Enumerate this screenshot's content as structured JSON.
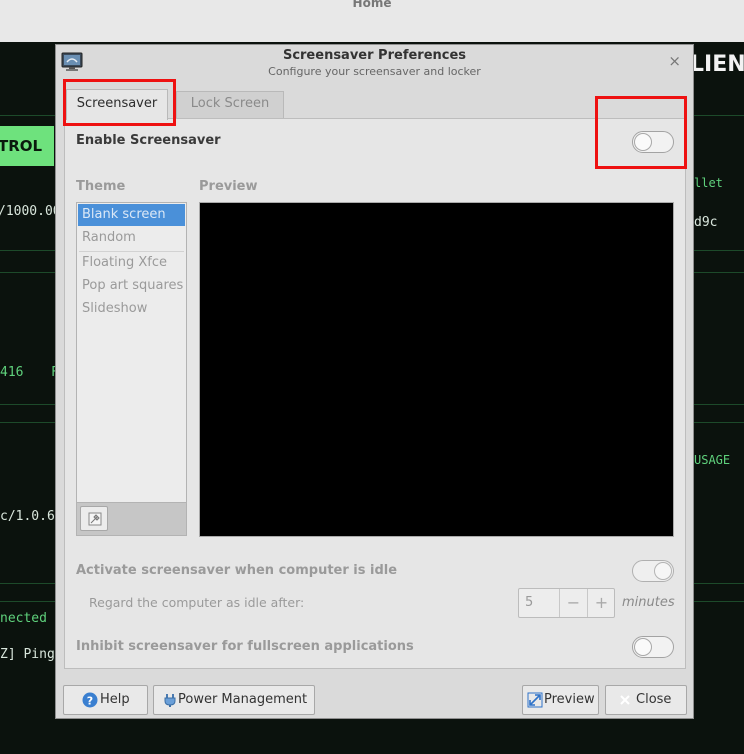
{
  "background_window": {
    "title": "Home",
    "fragments": {
      "client_header": "LIEN",
      "control_badge": "TROL",
      "value_1": "/1000.00",
      "wallet": "llet",
      "hash": "d9c",
      "num": "416",
      "letter_f": "F",
      "usage": "USAGE",
      "version": "c/1.0.6",
      "connected": "nected t",
      "pinging": "Z] Pingin"
    }
  },
  "dialog": {
    "title": "Screensaver Preferences",
    "subtitle": "Configure your screensaver and locker",
    "close_glyph": "×",
    "tabs": [
      {
        "label": "Screensaver",
        "active": true
      },
      {
        "label": "Lock Screen",
        "active": false
      }
    ],
    "enable_label": "Enable Screensaver",
    "enable_on": false,
    "theme_header": "Theme",
    "preview_header": "Preview",
    "themes": [
      "Blank screen",
      "Random",
      "Floating Xfce",
      "Pop art squares",
      "Slideshow"
    ],
    "selected_theme": "Blank screen",
    "activate_label": "Activate screensaver when computer is idle",
    "activate_on": true,
    "idle_label": "Regard the computer as idle after:",
    "idle_value": "5",
    "idle_minus": "−",
    "idle_plus": "+",
    "idle_unit": "minutes",
    "inhibit_label": "Inhibit screensaver for fullscreen applications",
    "inhibit_on": false,
    "buttons": {
      "help": "Help",
      "power": "Power Management",
      "preview": "Preview",
      "close": "Close"
    }
  },
  "colors": {
    "highlight": "#ee1111",
    "selection": "#4a90d9",
    "terminal_green": "#6ee27d"
  }
}
